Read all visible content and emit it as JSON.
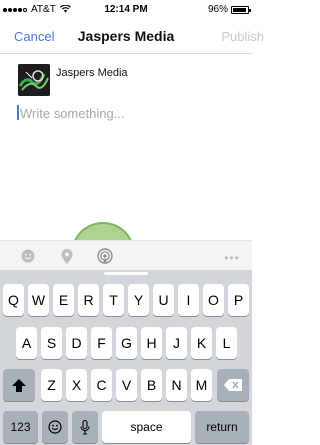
{
  "status_bar": {
    "carrier": "AT&T",
    "time": "12:14 PM",
    "battery": "96%",
    "battery_level": 0.96
  },
  "nav": {
    "cancel_label": "Cancel",
    "title": "Jaspers Media",
    "publish_label": "Publish"
  },
  "composer": {
    "page_name": "Jaspers Media",
    "placeholder": "Write something..."
  },
  "toolbar": {
    "icons": [
      "emoji-icon",
      "location-pin-icon",
      "broadcast-icon",
      "more-icon"
    ],
    "more_label": "•••"
  },
  "keyboard": {
    "row1": [
      "Q",
      "W",
      "E",
      "R",
      "T",
      "Y",
      "U",
      "I",
      "O",
      "P"
    ],
    "row2": [
      "A",
      "S",
      "D",
      "F",
      "G",
      "H",
      "J",
      "K",
      "L"
    ],
    "row3": [
      "Z",
      "X",
      "C",
      "V",
      "B",
      "N",
      "M"
    ],
    "numbers_label": "123",
    "space_label": "space",
    "return_label": "return"
  },
  "colors": {
    "accent": "#4a7ae8",
    "tap_indicator": "#91c46c",
    "keyboard_bg": "#d3d6db"
  }
}
